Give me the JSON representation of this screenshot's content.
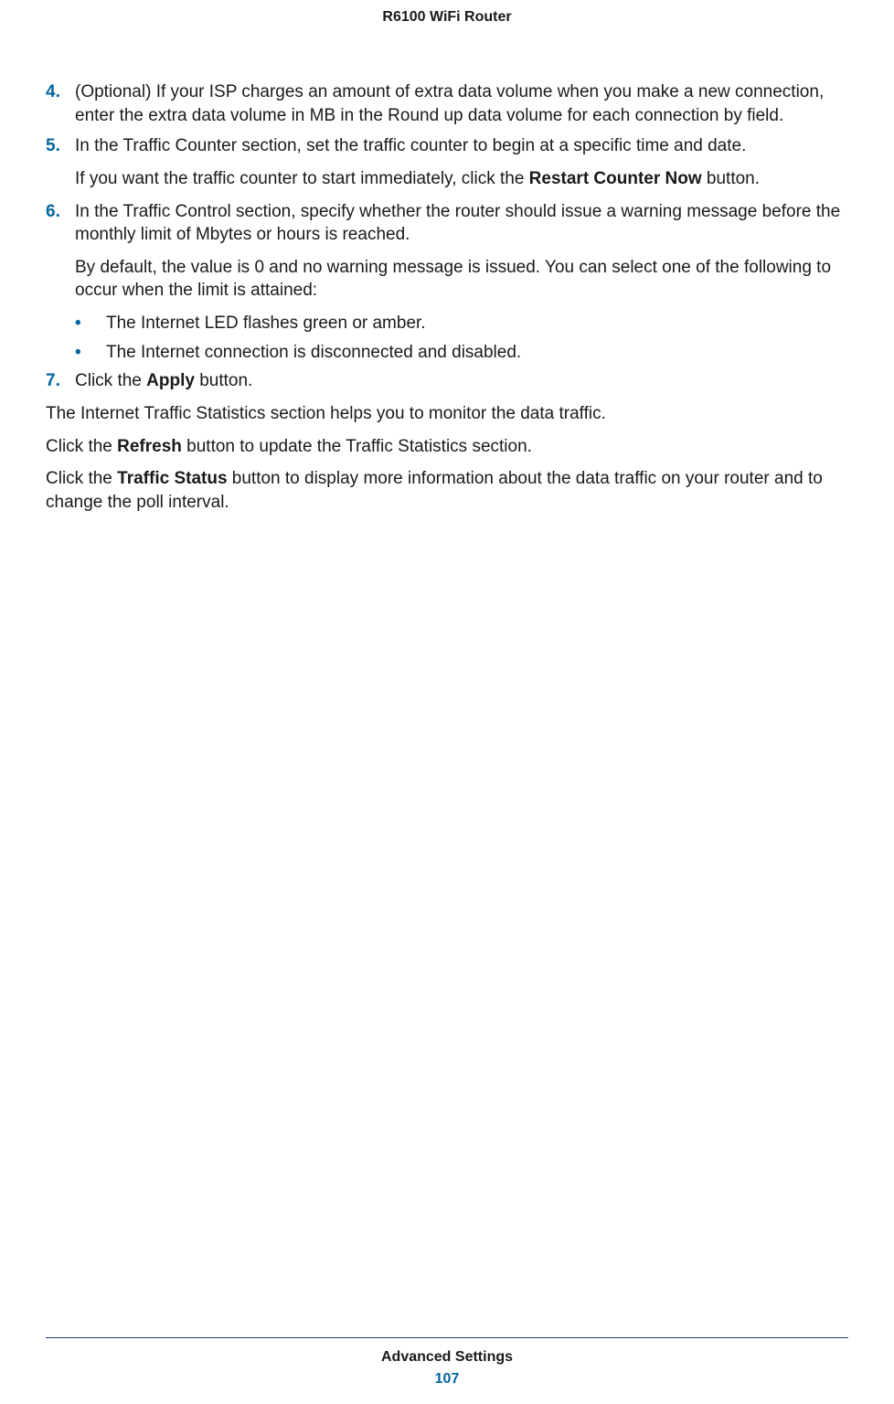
{
  "header": {
    "title": "R6100 WiFi Router"
  },
  "steps": {
    "s4": {
      "num": "4.",
      "text": "(Optional) If your ISP charges an amount of extra data volume when you make a new connection, enter the extra data volume in MB in the Round up data volume for each connection by field."
    },
    "s5": {
      "num": "5.",
      "text": "In the Traffic Counter section, set the traffic counter to begin at a specific time and date.",
      "sub_a": "If you want the traffic counter to start immediately, click the ",
      "sub_bold": "Restart Counter Now",
      "sub_b": " button."
    },
    "s6": {
      "num": "6.",
      "text": "In the Traffic Control section, specify whether the router should issue a warning message before the monthly limit of Mbytes or hours is reached.",
      "sub": "By default, the value is 0 and no warning message is issued. You can select one of the following to occur when the limit is attained:",
      "bullet1": "The Internet LED flashes green or amber.",
      "bullet2": "The Internet connection is disconnected and disabled."
    },
    "s7": {
      "num": "7.",
      "text_a": "Click the ",
      "text_bold": "Apply",
      "text_b": " button."
    }
  },
  "paras": {
    "p1": "The Internet Traffic Statistics section helps you to monitor the data traffic.",
    "p2_a": "Click the ",
    "p2_bold": "Refresh",
    "p2_b": " button to update the Traffic Statistics section.",
    "p3_a": "Click the ",
    "p3_bold": "Traffic Status",
    "p3_b": " button to display more information about the data traffic on your router and to change the poll interval."
  },
  "bullet_marker": "•",
  "footer": {
    "section": "Advanced Settings",
    "page": "107"
  }
}
